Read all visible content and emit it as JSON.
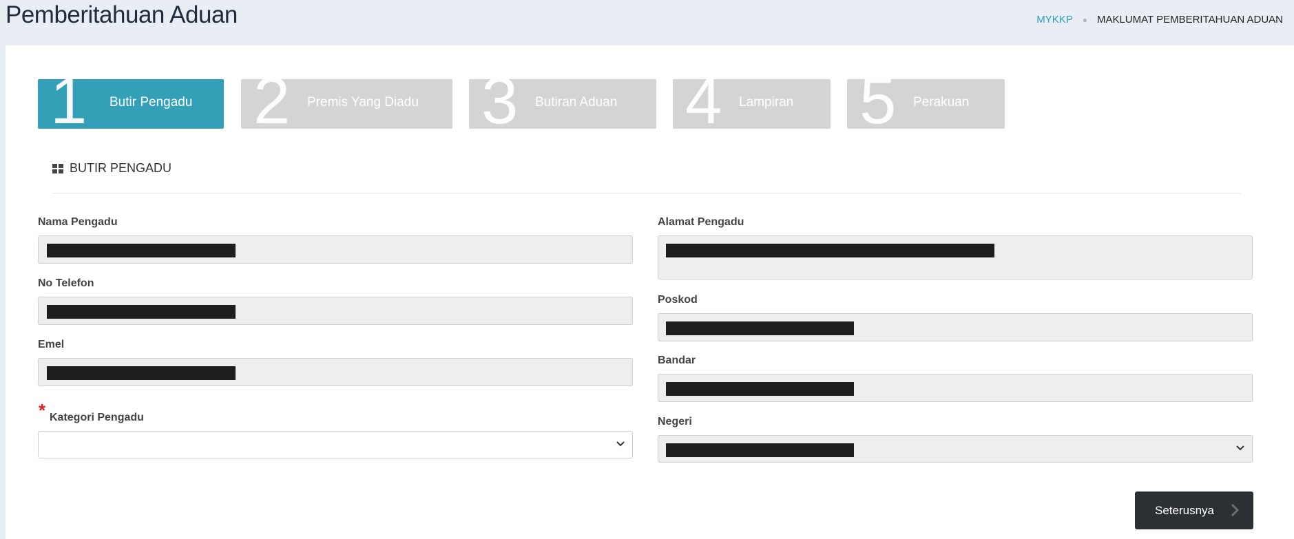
{
  "page": {
    "title": "Pemberitahuan Aduan"
  },
  "breadcrumb": {
    "home": "MYKKP",
    "current": "MAKLUMAT PEMBERITAHUAN ADUAN"
  },
  "steps": [
    {
      "num": "1",
      "label": "Butir Pengadu",
      "active": true
    },
    {
      "num": "2",
      "label": "Premis Yang Diadu",
      "active": false
    },
    {
      "num": "3",
      "label": "Butiran Aduan",
      "active": false
    },
    {
      "num": "4",
      "label": "Lampiran",
      "active": false
    },
    {
      "num": "5",
      "label": "Perakuan",
      "active": false
    }
  ],
  "section": {
    "title": "BUTIR PENGADU",
    "icon": "grid-icon"
  },
  "form": {
    "nama_label": "Nama Pengadu",
    "telefon_label": "No Telefon",
    "emel_label": "Emel",
    "kategori_label": "Kategori Pengadu",
    "kategori_required_mark": "*",
    "kategori_value": "",
    "alamat_label": "Alamat Pengadu",
    "poskod_label": "Poskod",
    "bandar_label": "Bandar",
    "negeri_label": "Negeri"
  },
  "actions": {
    "next_label": "Seterusnya"
  },
  "colors": {
    "accent": "#33a0b8",
    "inactive_step": "#d4d4d4",
    "button": "#2c2f33",
    "required": "#e01f1f",
    "redaction": "#1e1e1e"
  }
}
